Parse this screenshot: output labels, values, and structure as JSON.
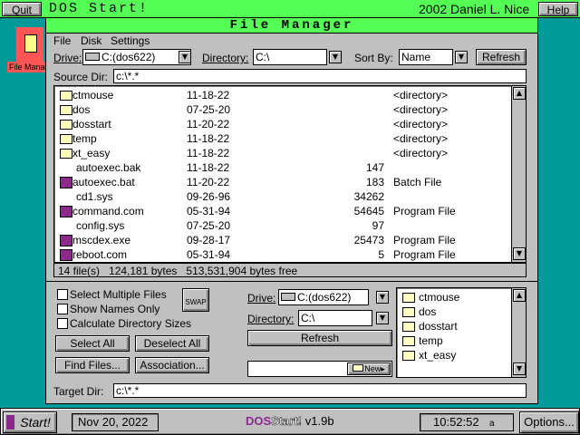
{
  "topbar": {
    "quit": "Quit",
    "app_title": "DOS Start!",
    "copyright": "2002 Daniel L. Nice",
    "help": "Help"
  },
  "desktop_icon": {
    "label": "File Manager"
  },
  "window": {
    "title": "File Manager",
    "menu": [
      "File",
      "Disk",
      "Settings"
    ]
  },
  "toolbar": {
    "drive_label": "Drive:",
    "drive_value": "C:(dos622)",
    "directory_label": "Directory:",
    "directory_value": "C:\\",
    "sort_label": "Sort By:",
    "sort_value": "Name",
    "refresh": "Refresh"
  },
  "source": {
    "label": "Source Dir:",
    "value": "c:\\*.*"
  },
  "files": [
    {
      "name": "ctmouse",
      "date": "11-18-22",
      "size": "",
      "type": "<directory>",
      "icon": "folder"
    },
    {
      "name": "dos",
      "date": "07-25-20",
      "size": "",
      "type": "<directory>",
      "icon": "folder"
    },
    {
      "name": "dosstart",
      "date": "11-20-22",
      "size": "",
      "type": "<directory>",
      "icon": "folder"
    },
    {
      "name": "temp",
      "date": "11-18-22",
      "size": "",
      "type": "<directory>",
      "icon": "folder"
    },
    {
      "name": "xt_easy",
      "date": "11-18-22",
      "size": "",
      "type": "<directory>",
      "icon": "folder"
    },
    {
      "name": "autoexec.bak",
      "date": "11-18-22",
      "size": "147",
      "type": "",
      "icon": "none"
    },
    {
      "name": "autoexec.bat",
      "date": "11-20-22",
      "size": "183",
      "type": "Batch File",
      "icon": "dos"
    },
    {
      "name": "cd1.sys",
      "date": "09-26-96",
      "size": "34262",
      "type": "",
      "icon": "none"
    },
    {
      "name": "command.com",
      "date": "05-31-94",
      "size": "54645",
      "type": "Program File",
      "icon": "dos"
    },
    {
      "name": "config.sys",
      "date": "07-25-20",
      "size": "97",
      "type": "",
      "icon": "none"
    },
    {
      "name": "mscdex.exe",
      "date": "09-28-17",
      "size": "25473",
      "type": "Program File",
      "icon": "dos"
    },
    {
      "name": "reboot.com",
      "date": "05-31-94",
      "size": "5",
      "type": "Program File",
      "icon": "dos"
    }
  ],
  "status": {
    "text": "14 file(s)   124,181 bytes   513,531,904 bytes free"
  },
  "options": {
    "select_multiple": "Select Multiple Files",
    "show_names": "Show Names Only",
    "calc_sizes": "Calculate Directory Sizes",
    "swap": "SWAP"
  },
  "buttons": {
    "select_all": "Select All",
    "deselect_all": "Deselect All",
    "find_files": "Find Files...",
    "association": "Association..."
  },
  "target": {
    "drive_label": "Drive:",
    "drive_value": "C:(dos622)",
    "directory_label": "Directory:",
    "directory_value": "C:\\",
    "refresh": "Refresh",
    "new_label": "New",
    "label": "Target Dir:",
    "value": "c:\\*.*"
  },
  "target_dirs": [
    "ctmouse",
    "dos",
    "dosstart",
    "temp",
    "xt_easy"
  ],
  "taskbar": {
    "start": "Start!",
    "date": "Nov 20, 2022",
    "brand_dos": "DOS",
    "brand_start": "Start!",
    "version": "v1.9b",
    "time": "10:52:52",
    "ampm": "a",
    "options": "Options..."
  },
  "colors": {
    "desktop": "#009a9a",
    "title_green": "#55ff55",
    "panel": "#c0c0c0",
    "dos_icon": "#8b2a8b"
  }
}
